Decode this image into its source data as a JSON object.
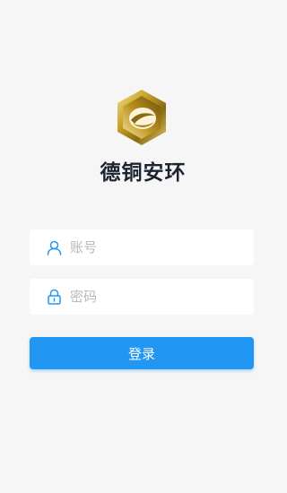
{
  "app": {
    "title": "德铜安环"
  },
  "form": {
    "account_placeholder": "账号",
    "password_placeholder": "密码",
    "login_label": "登录"
  },
  "icons": {
    "logo": "hexagon-gold-logo",
    "account": "user-icon",
    "password": "lock-icon"
  },
  "colors": {
    "accent": "#2196f3",
    "background": "#f6f6f6",
    "title": "#1b2230",
    "logo_gold": "#c9a227"
  }
}
